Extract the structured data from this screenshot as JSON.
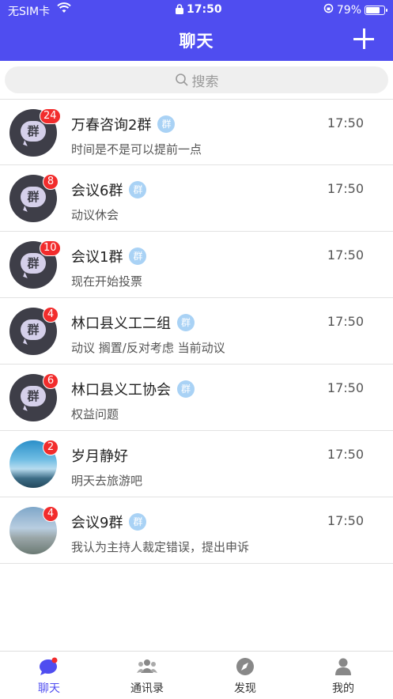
{
  "status_bar": {
    "carrier": "无SIM卡",
    "time": "17:50",
    "battery": "79%",
    "battery_level": 0.79
  },
  "header": {
    "title": "聊天",
    "add_icon": "plus-icon"
  },
  "search": {
    "placeholder": "搜索"
  },
  "group_tag": "群",
  "chats": [
    {
      "name": "万春咨询2群",
      "is_group": true,
      "badge": "24",
      "last_message": "时间是不是可以提前一点",
      "time": "17:50",
      "avatar": "group"
    },
    {
      "name": "会议6群",
      "is_group": true,
      "badge": "8",
      "last_message": "动议休会",
      "time": "17:50",
      "avatar": "group"
    },
    {
      "name": "会议1群",
      "is_group": true,
      "badge": "10",
      "last_message": "现在开始投票",
      "time": "17:50",
      "avatar": "group"
    },
    {
      "name": "林口县义工二组",
      "is_group": true,
      "badge": "4",
      "last_message": "动议 搁置/反对考虑 当前动议",
      "time": "17:50",
      "avatar": "group"
    },
    {
      "name": "林口县义工协会",
      "is_group": true,
      "badge": "6",
      "last_message": "权益问题",
      "time": "17:50",
      "avatar": "group"
    },
    {
      "name": "岁月静好",
      "is_group": false,
      "badge": "2",
      "last_message": "明天去旅游吧",
      "time": "17:50",
      "avatar": "photo-mountains"
    },
    {
      "name": "会议9群",
      "is_group": true,
      "badge": "4",
      "last_message": "我认为主持人裁定错误，提出申诉",
      "time": "17:50",
      "avatar": "photo-city"
    }
  ],
  "tabs": [
    {
      "label": "聊天",
      "icon": "chat-bubble-icon",
      "active": true
    },
    {
      "label": "通讯录",
      "icon": "contacts-icon",
      "active": false
    },
    {
      "label": "发现",
      "icon": "compass-icon",
      "active": false
    },
    {
      "label": "我的",
      "icon": "person-icon",
      "active": false
    }
  ],
  "colors": {
    "accent": "#4f4df0",
    "badge": "#f22c2c",
    "group_tag": "#a9d2f5"
  }
}
